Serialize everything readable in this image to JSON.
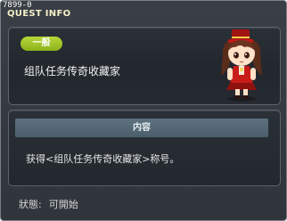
{
  "header": {
    "quest_id": "7899-0",
    "title": "QUEST INFO"
  },
  "quest": {
    "category": "一般",
    "name": "组队任务传奇收藏家"
  },
  "content": {
    "header": "内容",
    "text": "获得<组队任务传奇收藏家>称号。"
  },
  "status": {
    "label": "狀態:",
    "value": "可開始"
  },
  "colors": {
    "badge": "#9cc226",
    "panel_bg": "#262b31",
    "window_bg": "#353a41",
    "title": "#f5f1c8",
    "content_header": "#536775"
  }
}
